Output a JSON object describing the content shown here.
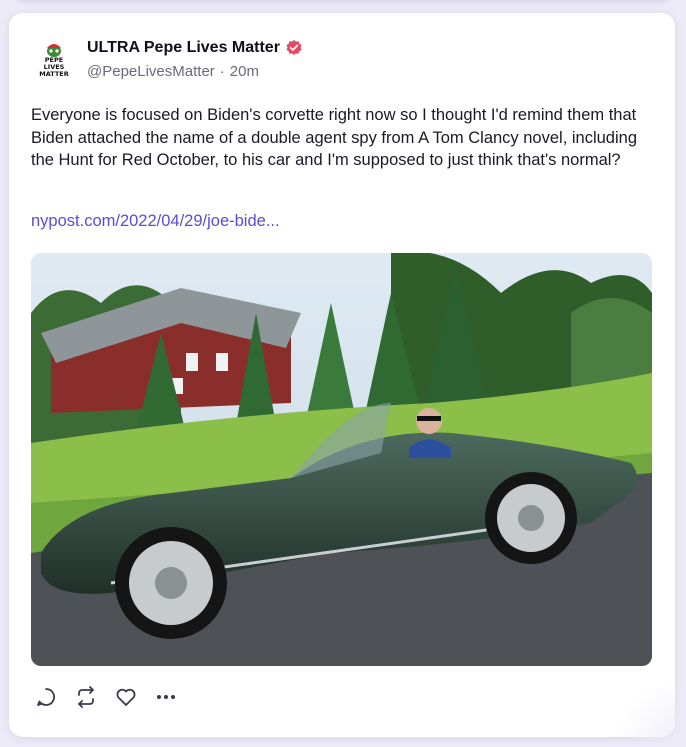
{
  "post": {
    "author_name": "ULTRA Pepe Lives Matter",
    "handle": "@PepeLivesMatter",
    "separator": "·",
    "time": "20m",
    "verified_icon": "verified-badge-icon",
    "avatar_text": [
      "PEPE",
      "LIVES",
      "MATTER"
    ],
    "text": "Everyone is focused on Biden's corvette right now so I thought I'd remind them that Biden attached the name of a double agent spy from A Tom Clancy novel, including the Hunt for Red October, to his car and I'm supposed to just think that's normal?",
    "link": "nypost.com/2022/04/29/joe-bide...",
    "image": {
      "subject": "green-convertible-corvette-photo"
    }
  },
  "actions": {
    "icons": [
      "reply-icon",
      "repost-icon",
      "like-icon",
      "more-icon"
    ]
  },
  "colors": {
    "accent": "#5b4bd6",
    "verified": "#e8475f",
    "background": "#eceaf6"
  }
}
